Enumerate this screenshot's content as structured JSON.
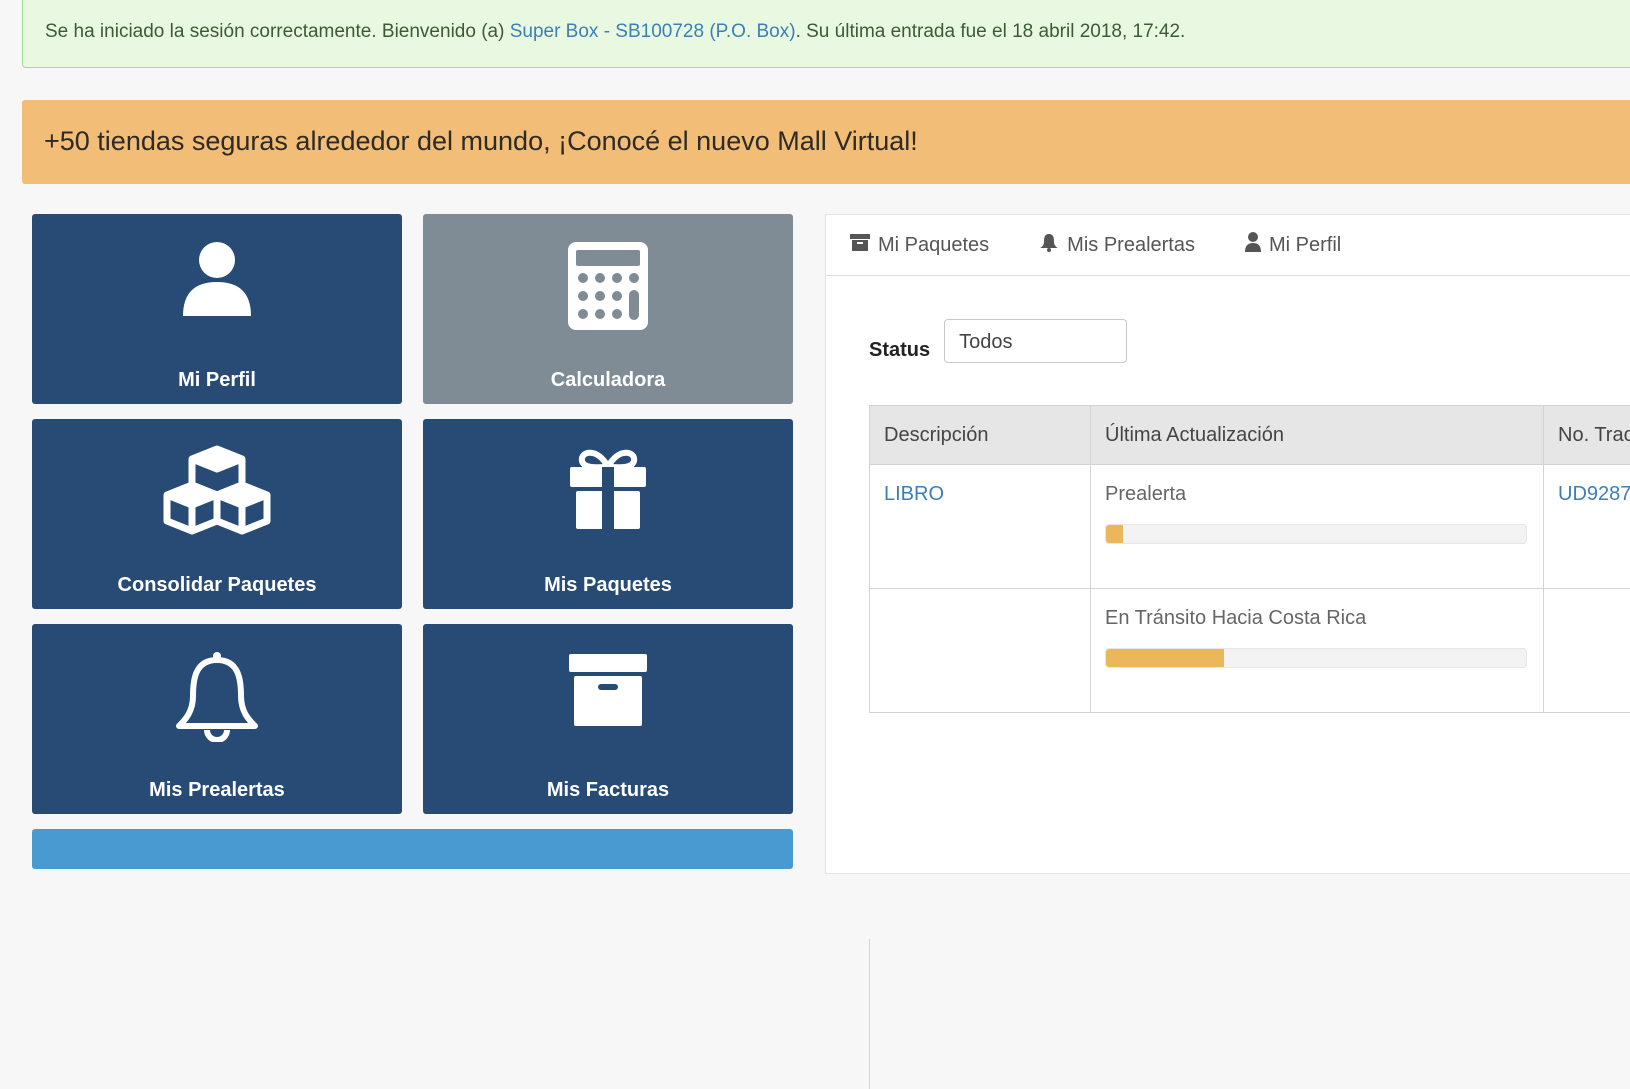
{
  "alert": {
    "prefix": "Se ha iniciado la sesión correctamente. Bienvenido (a) ",
    "account_link": "Super Box - SB100728 (P.O. Box)",
    "suffix": ". Su última entrada fue el 18 abril 2018, 17:42."
  },
  "promo": {
    "text": "+50 tiendas seguras alrededor del mundo, ¡Conocé el nuevo Mall Virtual!"
  },
  "tiles": [
    {
      "label": "Mi Perfil",
      "icon": "user-icon"
    },
    {
      "label": "Calculadora",
      "icon": "calculator-icon"
    },
    {
      "label": "Consolidar Paquetes",
      "icon": "cubes-icon"
    },
    {
      "label": "Mis Paquetes",
      "icon": "gift-icon"
    },
    {
      "label": "Mis Prealertas",
      "icon": "bell-icon"
    },
    {
      "label": "Mis Facturas",
      "icon": "archive-icon"
    }
  ],
  "tabs": [
    {
      "label": "Mi Paquetes",
      "icon": "archive-icon"
    },
    {
      "label": "Mis Prealertas",
      "icon": "bell-icon"
    },
    {
      "label": "Mi Perfil",
      "icon": "user-icon"
    }
  ],
  "filter": {
    "label": "Status",
    "value": "Todos"
  },
  "table": {
    "headers": [
      "Descripción",
      "Última Actualización",
      "No. Trac"
    ],
    "rows": [
      {
        "description": "LIBRO",
        "status": "Prealerta",
        "progress": 0.04,
        "tracking": "UD9287"
      },
      {
        "description": "",
        "status": "En Tránsito Hacia Costa Rica",
        "progress": 0.28,
        "tracking": ""
      }
    ]
  },
  "colors": {
    "tile_blue": "#274b75",
    "tile_gray": "#7f8c96",
    "promo_orange": "#f1bd77",
    "progress_fill": "#ebb75b",
    "link_blue": "#3b7fb6"
  }
}
